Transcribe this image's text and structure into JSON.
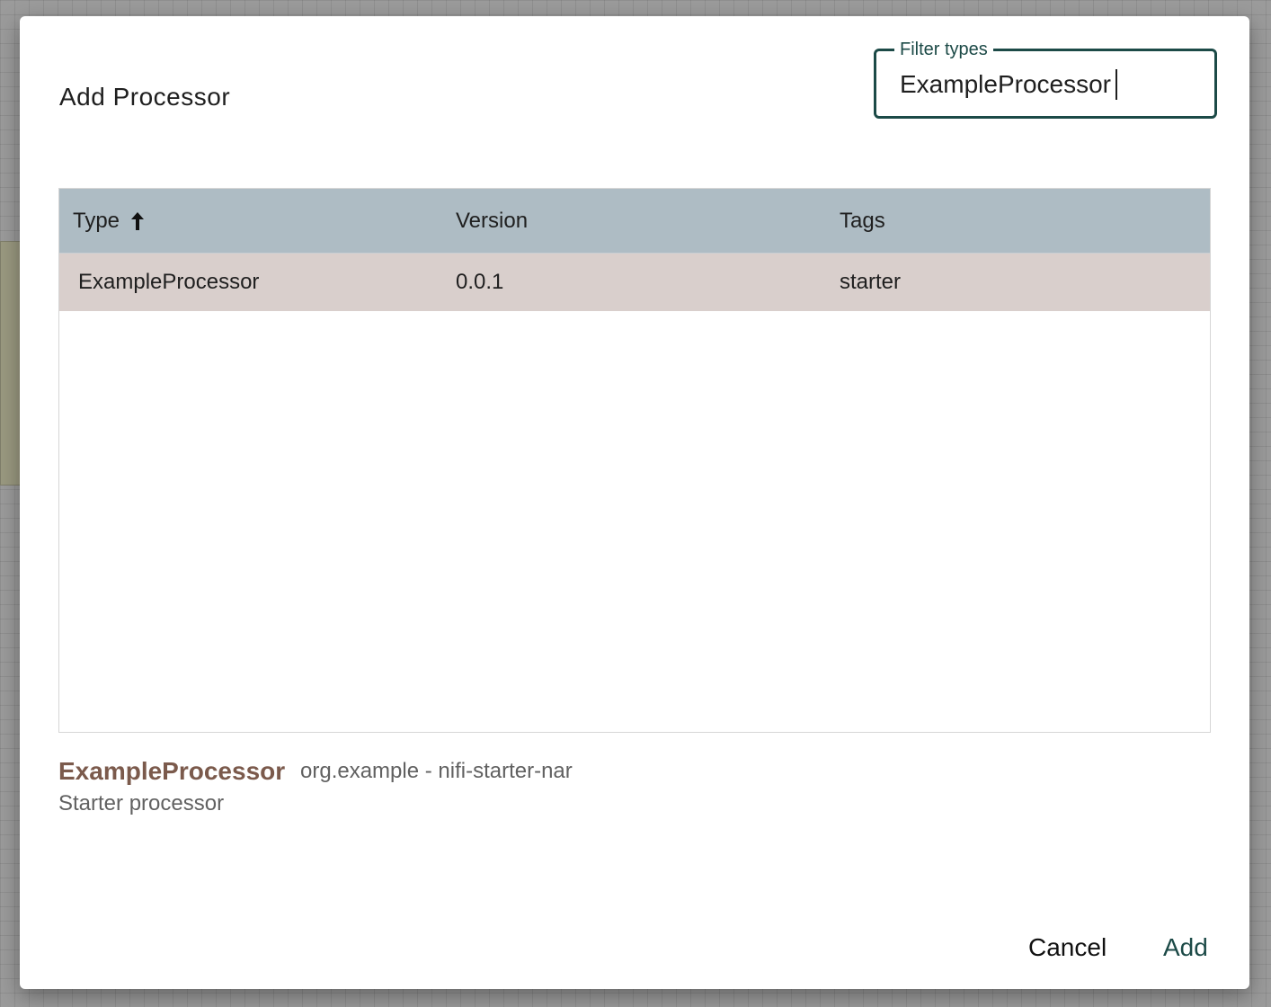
{
  "dialog": {
    "title": "Add Processor",
    "filter": {
      "label": "Filter types",
      "value": "ExampleProcessor"
    },
    "table": {
      "columns": [
        "Type",
        "Version",
        "Tags"
      ],
      "sorted_column": "Type",
      "sort_direction": "ascending",
      "rows": [
        {
          "type": "ExampleProcessor",
          "version": "0.0.1",
          "tags": "starter"
        }
      ]
    },
    "selected": {
      "name": "ExampleProcessor",
      "bundle": "org.example - nifi-starter-nar",
      "description": "Starter processor"
    },
    "actions": {
      "cancel_label": "Cancel",
      "add_label": "Add"
    }
  },
  "colors": {
    "accent": "#1c4a47",
    "header_bg": "#aebcc4",
    "selected_row_bg": "#d9cfcc",
    "selected_name": "#7b5a4c"
  }
}
